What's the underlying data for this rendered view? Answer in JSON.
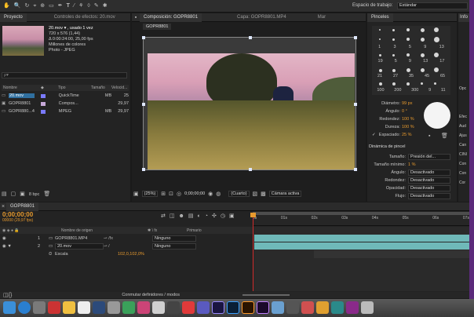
{
  "menubar": {
    "workspace_label": "Espacio de trabajo:",
    "workspace_value": "Estándar"
  },
  "project": {
    "tab_label": "Proyecto",
    "effects_tab_label": "Controles de efectos: 20.mov",
    "info_lines": [
      "20.mov ▾ , usado 1 vez",
      "720 x 576 (1,44)",
      "Δ 0:00:24:00, 25,00 fps",
      "Millones de colores",
      "Photo - JPEG"
    ],
    "search_placeholder": "ρ▾",
    "columns": [
      "Nombre",
      "Tipo",
      "Tamaño",
      "Velocid..."
    ],
    "items": [
      {
        "name": "20.mov",
        "type": "QuickTime",
        "size": "MB",
        "fps": "25",
        "selected": true
      },
      {
        "name": "GOPR8801",
        "type": "Compos...",
        "size": "",
        "fps": "29,97",
        "selected": false
      },
      {
        "name": "GOPR880...4",
        "type": "MPEG",
        "size": "MB",
        "fps": "29,97",
        "selected": false
      }
    ],
    "bpc_label": "8 bpc"
  },
  "composition": {
    "tab_label": "Composición: GOPR8801",
    "layer_tab_label": "Capa: GOPR8801.MP4",
    "more_tab_label": "Mar",
    "comp_name": "GOPR8801",
    "zoom": "(25%)",
    "timecode": "0;00;00;00",
    "view_option": "(Cuarto)",
    "camera": "Cámara activa"
  },
  "brushes": {
    "tab_label": "Pinceles",
    "sizes": [
      "1",
      "3",
      "5",
      "9",
      "13",
      "19",
      "5",
      "9",
      "13",
      "17",
      "21",
      "27",
      "35",
      "45",
      "65",
      "100",
      "200",
      "300",
      "9",
      "11"
    ],
    "diameter_label": "Diámetro:",
    "diameter_value": "99 px",
    "angle_label": "Ángulo:",
    "angle_value": "0 °",
    "roundness_label": "Redondez:",
    "roundness_value": "100 %",
    "hardness_label": "Dureza:",
    "hardness_value": "100 %",
    "spacing_label": "Espaciado:",
    "spacing_value": "25 %",
    "dynamics_title": "Dinámica de pincel",
    "size_label": "Tamaño:",
    "size_value": "Presión del...",
    "min_size_label": "Tamaño mínimo:",
    "min_size_value": "1 %",
    "d_angle_label": "Ángulo:",
    "d_angle_value": "Desactivado",
    "d_roundness_label": "Redondez:",
    "d_roundness_value": "Desactivado",
    "d_opacity_label": "Opacidad:",
    "d_opacity_value": "Desactivado",
    "d_flow_label": "Flujo:",
    "d_flow_value": "Desactivado"
  },
  "info": {
    "tab_label": "Info",
    "items": [
      "Opc",
      "Efec",
      "Aud",
      "Ajus",
      "Can",
      "CINI",
      "Con",
      "Con",
      "Cor"
    ]
  },
  "timeline": {
    "tab_label": "GOPR8801",
    "timecode": "0;00;00;00",
    "fps_note": "00000 (29,97 fps)",
    "col_source": "Nombre de origen",
    "col_parent": "Primario",
    "layers": [
      {
        "num": "1",
        "name": "GOPR8801.MP4",
        "parent": "Ninguno",
        "selected": false
      },
      {
        "num": "2",
        "name": "20.mov",
        "parent": "Ninguno",
        "selected": true
      }
    ],
    "scale_label": "Escala",
    "scale_value": "102,0,102,0%",
    "ruler": [
      "0s",
      "01s",
      "02s",
      "03s",
      "04s",
      "05s",
      "06s",
      "07s"
    ],
    "toggle_label": "Conmutar definidores / modos"
  },
  "colors": {
    "accent": "#e79a2e",
    "selection": "#2f6f9f",
    "track": "#6fb9b9",
    "playhead": "#d12b2b"
  }
}
